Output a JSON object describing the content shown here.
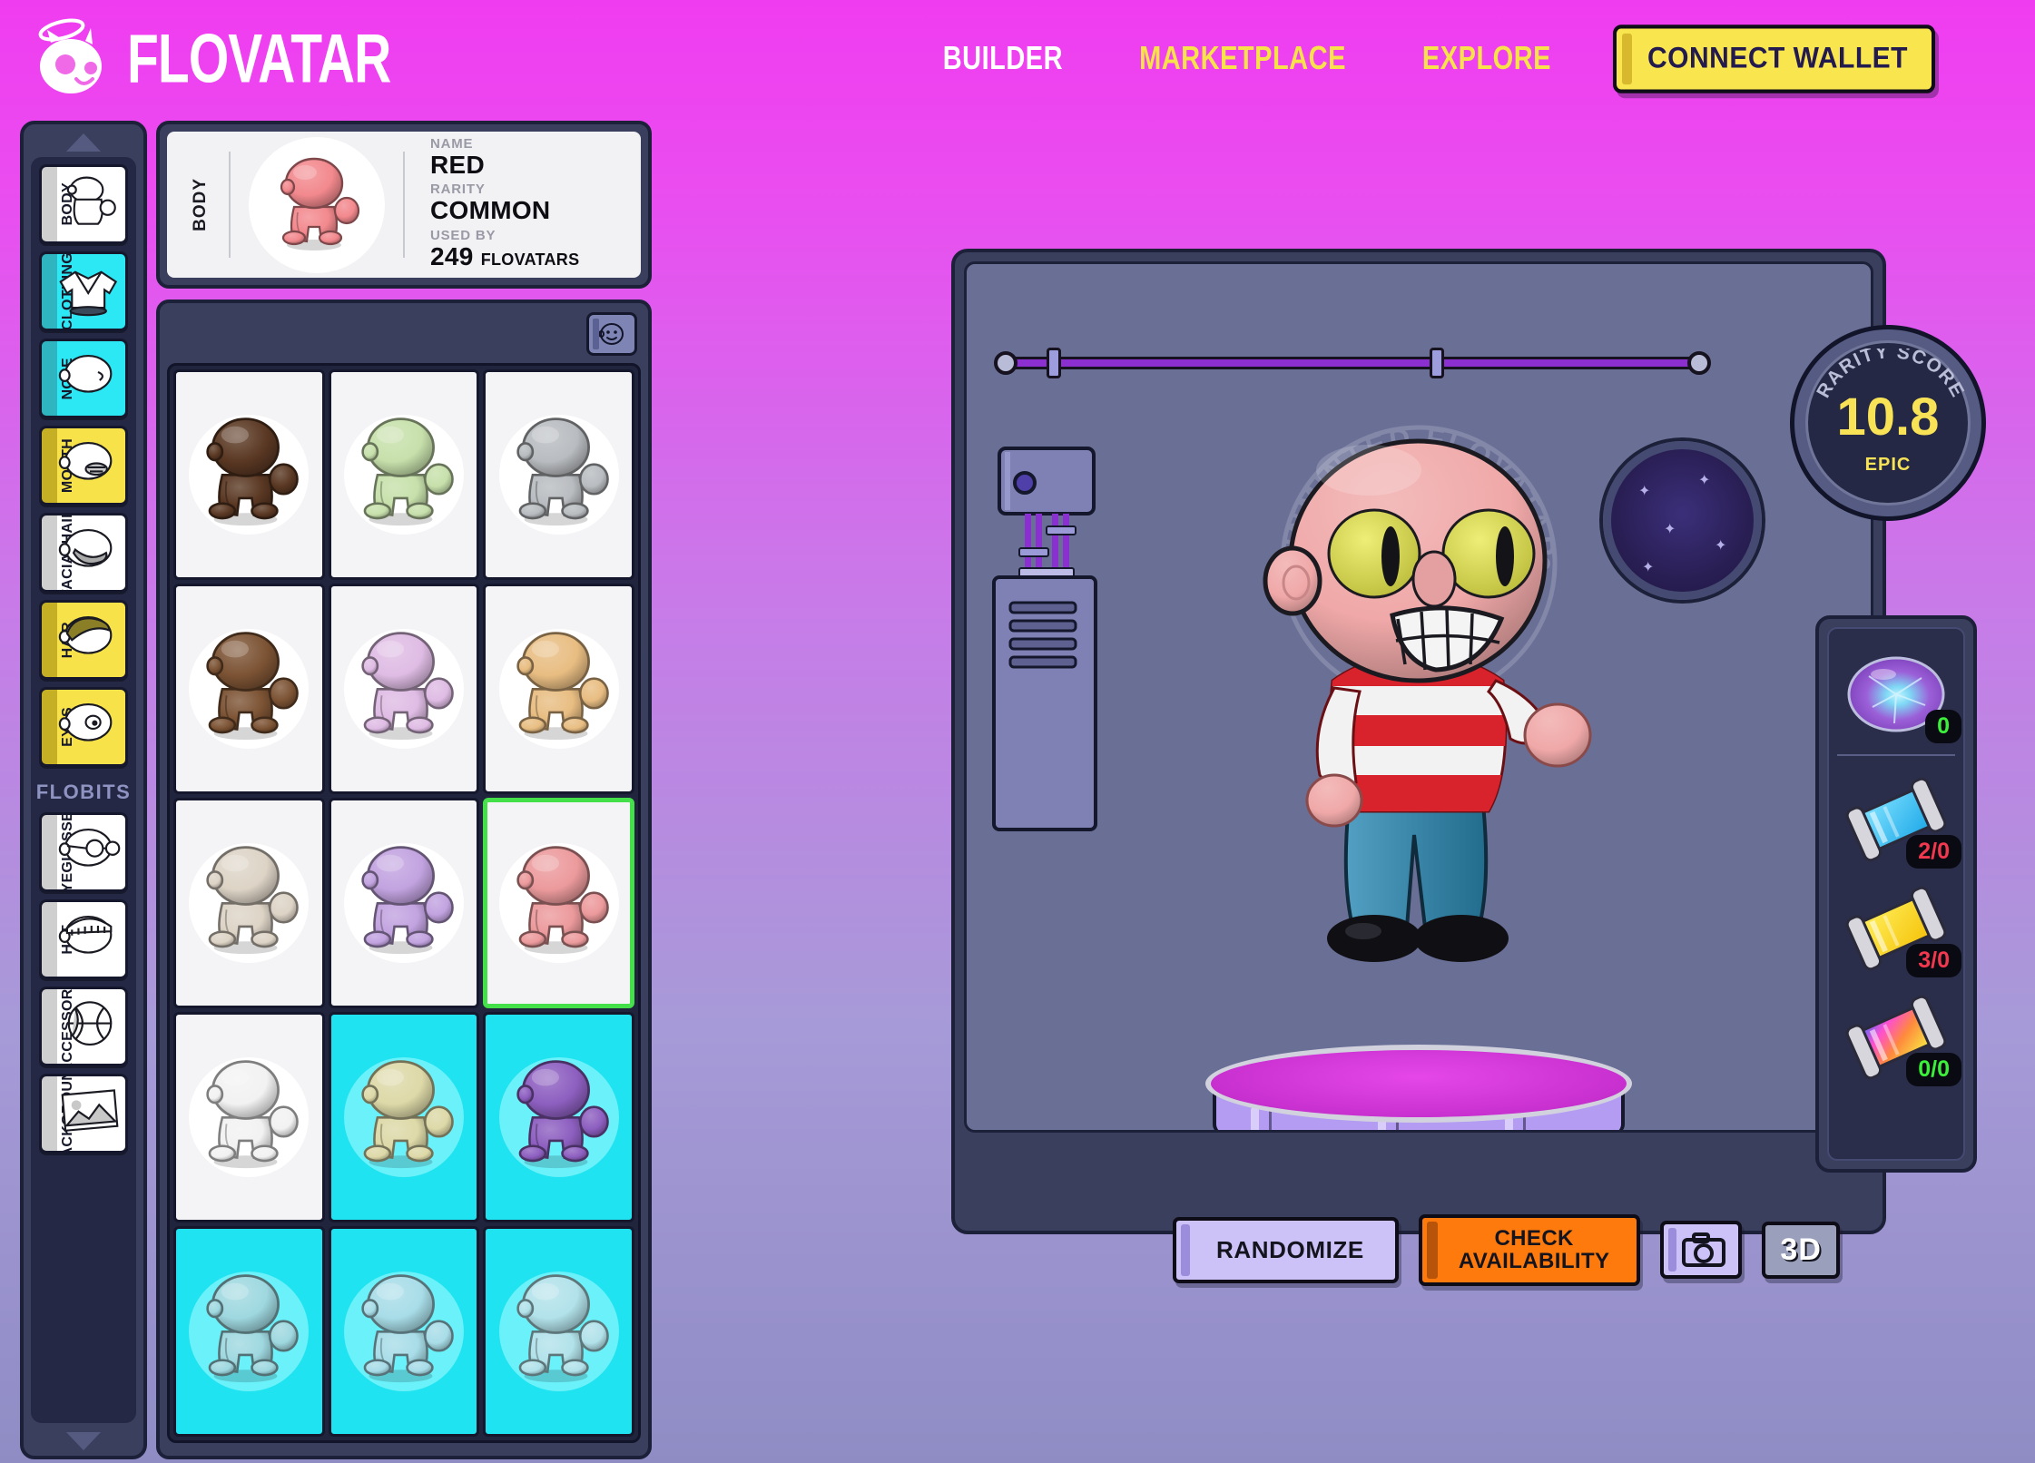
{
  "brand": {
    "name": "FLOVATAR",
    "logo_icon": "flovatar-head-icon"
  },
  "nav": {
    "items": [
      {
        "label": "BUILDER",
        "state": "active"
      },
      {
        "label": "MARKETPLACE",
        "state": "link"
      },
      {
        "label": "EXPLORE",
        "state": "link"
      }
    ],
    "wallet_button": "CONNECT WALLET"
  },
  "sidebar": {
    "scroll_up_icon": "chevron-up-icon",
    "scroll_down_icon": "chevron-down-icon",
    "flobits_header": "FLOBITS",
    "traits": [
      {
        "label": "BODY",
        "color": "#ffffff",
        "stripe": "#cfcfcf",
        "icon": "body-icon",
        "selected": true
      },
      {
        "label": "CLOTHING",
        "color": "#2ce8f5",
        "stripe": "#2fb5bf",
        "icon": "clothing-icon",
        "selected": false
      },
      {
        "label": "NOSE",
        "color": "#2ce8f5",
        "stripe": "#2fb5bf",
        "icon": "nose-icon",
        "selected": false
      },
      {
        "label": "MOUTH",
        "color": "#f7e24a",
        "stripe": "#c5b025",
        "icon": "mouth-icon",
        "selected": false
      },
      {
        "label": "FACIALHAIR",
        "color": "#ffffff",
        "stripe": "#cfcfcf",
        "icon": "facialhair-icon",
        "selected": false
      },
      {
        "label": "HAIR",
        "color": "#f7e24a",
        "stripe": "#c5b025",
        "icon": "hair-icon",
        "selected": false
      },
      {
        "label": "EYES",
        "color": "#f7e24a",
        "stripe": "#c5b025",
        "icon": "eyes-icon",
        "selected": false
      }
    ],
    "flobits": [
      {
        "label": "EYEGLASSES",
        "color": "#ffffff",
        "stripe": "#cfcfcf",
        "icon": "eyeglasses-icon"
      },
      {
        "label": "HAT",
        "color": "#ffffff",
        "stripe": "#cfcfcf",
        "icon": "hat-icon"
      },
      {
        "label": "ACCESSORY",
        "color": "#ffffff",
        "stripe": "#cfcfcf",
        "icon": "accessory-icon"
      },
      {
        "label": "BACKGROUND",
        "color": "#ffffff",
        "stripe": "#cfcfcf",
        "icon": "background-icon"
      }
    ]
  },
  "info_card": {
    "category": "BODY",
    "thumb_color": "#f2898e",
    "name_label": "NAME",
    "name_value": "RED",
    "rarity_label": "RARITY",
    "rarity_value": "COMMON",
    "used_by_label": "USED BY",
    "used_by_count": "249",
    "used_by_unit": "FLOVATARS"
  },
  "grid": {
    "face_toggle_icon": "face-icon",
    "items": [
      {
        "color": "#5a3823",
        "rare": false,
        "selected": false
      },
      {
        "color": "#c7e0ab",
        "rare": false,
        "selected": false
      },
      {
        "color": "#b9bcc0",
        "rare": false,
        "selected": false
      },
      {
        "color": "#7c5334",
        "rare": false,
        "selected": false
      },
      {
        "color": "#dfbce4",
        "rare": false,
        "selected": false
      },
      {
        "color": "#e8bd82",
        "rare": false,
        "selected": false
      },
      {
        "color": "#ddd4c6",
        "rare": false,
        "selected": false
      },
      {
        "color": "#c2a3e0",
        "rare": false,
        "selected": false
      },
      {
        "color": "#ec9a9c",
        "rare": false,
        "selected": true
      },
      {
        "color": "#f2f2f2",
        "rare": false,
        "selected": false
      },
      {
        "color": "#ddd9a8",
        "rare": true,
        "selected": false
      },
      {
        "color": "#8d5fc0",
        "rare": true,
        "selected": false
      },
      {
        "color": "#9fd8e0",
        "rare": true,
        "selected": false
      },
      {
        "color": "#a8dde8",
        "rare": true,
        "selected": false
      },
      {
        "color": "#b2e2ea",
        "rare": true,
        "selected": false
      }
    ]
  },
  "stage": {
    "watermark_text_top": "UNMINTED FLOVATAR",
    "watermark_text_bottom": "UNMINTED FLOVATAR",
    "watermark_logo": "F",
    "avatar": {
      "skin_color": "#f0a8a8",
      "eye_color": "#e8e84a",
      "shirt_stripe_a": "#d9232c",
      "shirt_stripe_b": "#f2f2f2",
      "pants_color": "#2b8ab5",
      "shoe_color": "#101014"
    },
    "platform_top_color": "#d22fd8",
    "platform_side_color": "#b39cf2"
  },
  "rarity_badge": {
    "title": "RARITY SCORE",
    "score": "10.8",
    "tier": "EPIC",
    "accent": "#f8e356"
  },
  "inventory": {
    "items": [
      {
        "icon": "dust-orb-icon",
        "count": "0",
        "state": "green"
      },
      {
        "icon": "cyan-component-icon",
        "count": "2/0",
        "state": "red"
      },
      {
        "icon": "yellow-component-icon",
        "count": "3/0",
        "state": "red"
      },
      {
        "icon": "rainbow-component-icon",
        "count": "0/0",
        "state": "green"
      }
    ]
  },
  "actions": {
    "randomize": "RANDOMIZE",
    "check_availability_line1": "CHECK",
    "check_availability_line2": "AVAILABILITY",
    "camera_icon": "camera-icon",
    "three_d": "3D"
  }
}
